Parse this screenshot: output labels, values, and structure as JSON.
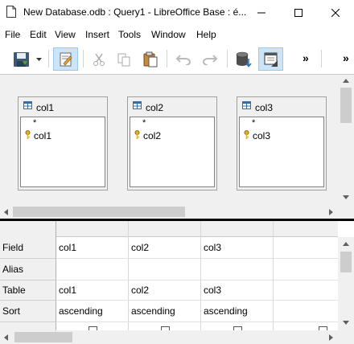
{
  "window": {
    "title": "New Database.odb : Query1 - LibreOffice Base : é..."
  },
  "menu": {
    "items": [
      "File",
      "Edit",
      "View",
      "Insert",
      "Tools",
      "Window",
      "Help"
    ]
  },
  "toolbar": {
    "icons": [
      "save-icon",
      "dropdown-arrow-icon",
      "edit-mode-icon",
      "cut-icon",
      "copy-icon",
      "paste-icon",
      "undo-icon",
      "redo-icon",
      "run-query-icon",
      "design-view-icon"
    ],
    "overflow": "»"
  },
  "tables": [
    {
      "title": "col1",
      "fields": [
        "*",
        "col1"
      ]
    },
    {
      "title": "col2",
      "fields": [
        "*",
        "col2"
      ]
    },
    {
      "title": "col3",
      "fields": [
        "*",
        "col3"
      ]
    }
  ],
  "grid": {
    "row_labels": [
      "Field",
      "Alias",
      "Table",
      "Sort"
    ],
    "columns": [
      {
        "field": "col1",
        "alias": "",
        "table": "col1",
        "sort": "ascending"
      },
      {
        "field": "col2",
        "alias": "",
        "table": "col2",
        "sort": "ascending"
      },
      {
        "field": "col3",
        "alias": "",
        "table": "col3",
        "sort": "ascending"
      }
    ]
  }
}
